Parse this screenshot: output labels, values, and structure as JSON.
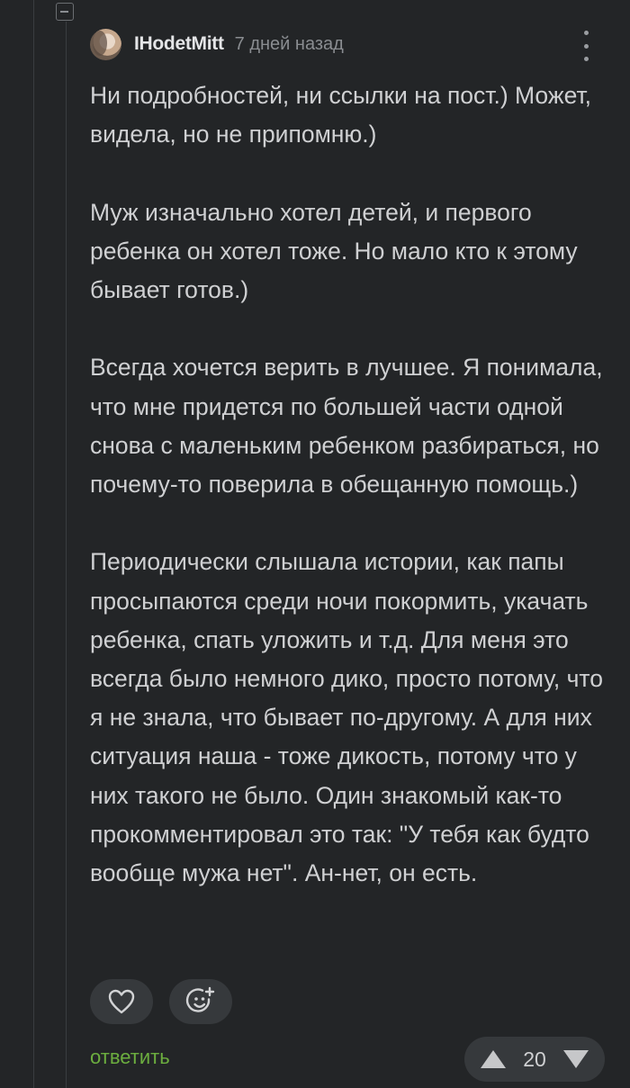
{
  "comment": {
    "author": "IHodetMitt",
    "time": "7 дней назад",
    "paragraphs": [
      "Ни подробностей, ни ссылки на пост.) Может, видела, но не припомню.)",
      "Муж изначально хотел детей, и первого ребенка он хотел тоже. Но мало кто к этому бывает готов.)",
      "Всегда хочется верить в лучшее. Я понимала, что мне придется по большей части одной снова с маленьким ребенком разбираться, но почему-то поверила в обещанную помощь.)",
      "Периодически слышала истории, как папы просыпаются среди ночи покормить, укачать ребенка, спать уложить и т.д. Для меня это всегда было немного дико, просто потому, что я не знала, что бывает по-другому. А для них ситуация наша - тоже дикость, потому что у них такого не было. Один знакомый как-то прокомментировал это так: \"У тебя как будто вообще мужа нет\". Ан-нет, он есть."
    ],
    "reply_label": "ответить",
    "rating": "20"
  },
  "icons": {
    "collapse": "minus-square-icon",
    "more": "vertical-dots-icon",
    "like": "heart-icon",
    "react": "add-emoji-icon",
    "upvote": "triangle-up-icon",
    "downvote": "triangle-down-icon"
  },
  "colors": {
    "background": "#232527",
    "text": "#cfd0d2",
    "muted": "#8a8d91",
    "button_bg": "#36393c",
    "reply": "#6cae3f"
  }
}
